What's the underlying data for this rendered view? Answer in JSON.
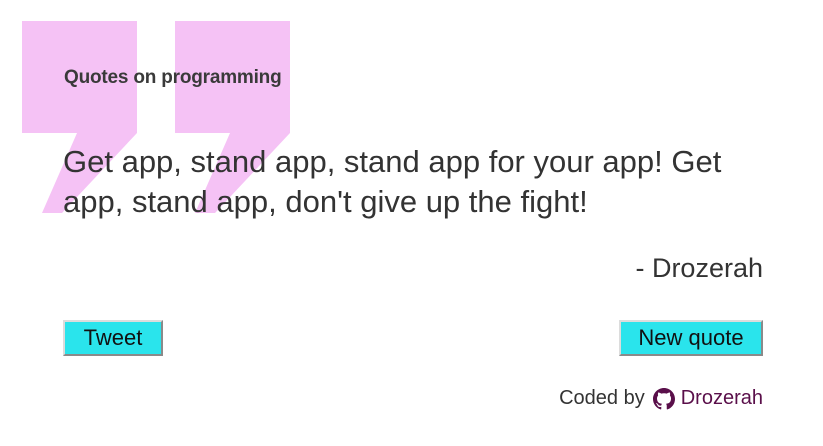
{
  "colors": {
    "quote_mark": "#f5c2f5",
    "button_bg": "#2ae4ec",
    "link": "#5a0f4a"
  },
  "heading": "Quotes on programming",
  "quote": {
    "text": "Get app, stand app, stand app for your app! Get app, stand app, don't give up the fight!",
    "author": "- Drozerah"
  },
  "buttons": {
    "tweet_label": "Tweet",
    "new_quote_label": "New quote"
  },
  "footer": {
    "coded_by_label": "Coded by",
    "icon": "github-icon",
    "author_link": "Drozerah"
  }
}
